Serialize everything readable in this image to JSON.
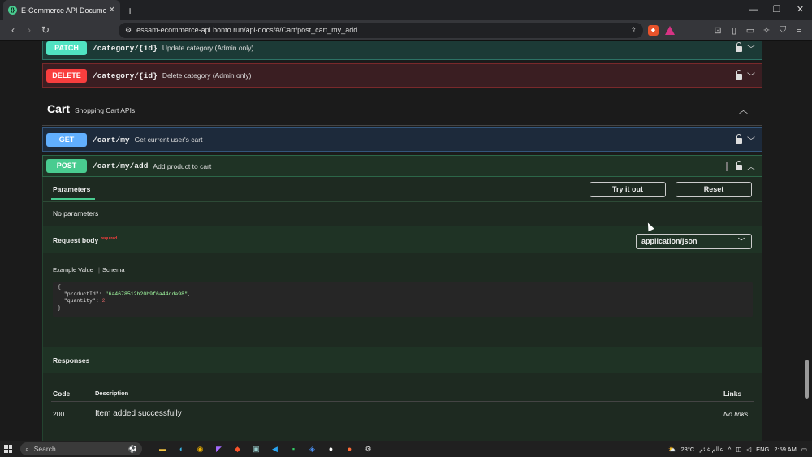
{
  "browser": {
    "tab_title": "E-Commerce API Documentation",
    "tab_close": "✕",
    "new_tab": "+",
    "url": "essam-ecommerce-api.bonto.run/api-docs/#/Cart/post_cart_my_add",
    "minimize": "—",
    "restore": "❐",
    "close": "✕"
  },
  "ops_top": [
    {
      "method": "PATCH",
      "path": "/category/{id}",
      "summary": "Update category (Admin only)",
      "color": "#50e3c2",
      "bg": "#1c3a36"
    },
    {
      "method": "DELETE",
      "path": "/category/{id}",
      "summary": "Delete category (Admin only)",
      "color": "#f93e3e",
      "bg": "#3a1e22"
    }
  ],
  "section": {
    "name": "Cart",
    "desc": "Shopping Cart APIs"
  },
  "get_op": {
    "method": "GET",
    "path": "/cart/my",
    "summary": "Get current user's cart",
    "color": "#61affe",
    "bg": "#1d2a3b"
  },
  "post_op": {
    "method": "POST",
    "path": "/cart/my/add",
    "summary": "Add product to cart",
    "color": "#49cc90",
    "bg": "#1f3325"
  },
  "params": {
    "tab": "Parameters",
    "try_it_out": "Try it out",
    "reset": "Reset",
    "none": "No parameters"
  },
  "request_body": {
    "label": "Request body",
    "required": "required",
    "content_type": "application/json",
    "example_value": "Example Value",
    "separator": "|",
    "schema": "Schema",
    "code_open": "{",
    "product_key": "\"productId\"",
    "product_val": "\"6a4678512b20b9f6a44dda98\"",
    "quantity_key": "\"quantity\"",
    "quantity_val": "2",
    "code_close": "}"
  },
  "responses": {
    "title": "Responses",
    "col_code": "Code",
    "col_desc": "Description",
    "col_links": "Links",
    "rows": [
      {
        "code": "200",
        "desc": "Item added successfully",
        "links": "No links"
      }
    ]
  },
  "taskbar": {
    "search": "Search",
    "weather": "23°C",
    "weather_text": "عالم غائم",
    "lang": "ENG",
    "time": "2:59 AM"
  }
}
